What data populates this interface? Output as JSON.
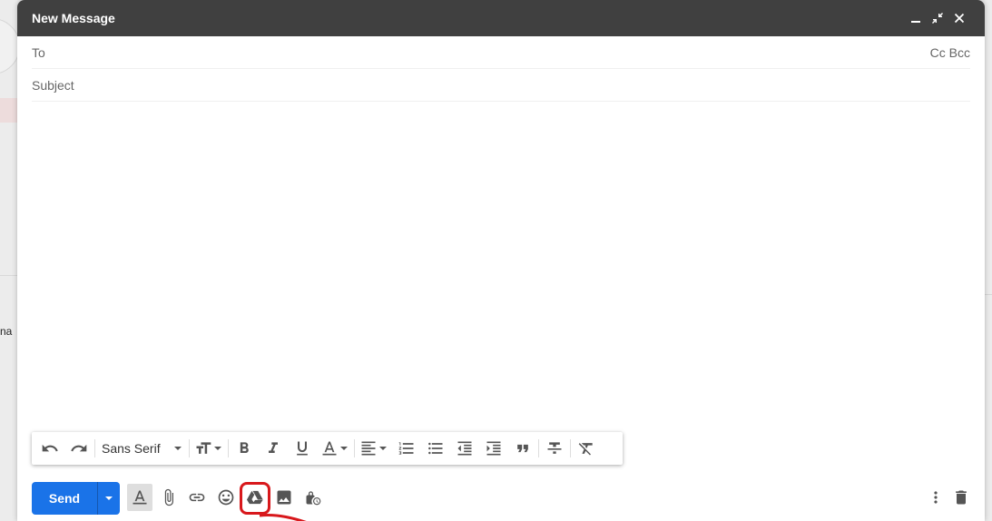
{
  "window": {
    "title": "New Message",
    "controls": [
      "minimize-icon",
      "exit-fullscreen-icon",
      "close-icon"
    ]
  },
  "recipients": {
    "to_placeholder": "To",
    "cc_label": "Cc",
    "bcc_label": "Bcc"
  },
  "subject": {
    "placeholder": "Subject"
  },
  "formatting_toolbar": {
    "font_family": "Sans Serif",
    "buttons": [
      "undo-icon",
      "redo-icon",
      "font-size-icon",
      "bold-icon",
      "italic-icon",
      "underline-icon",
      "text-color-icon",
      "align-icon",
      "numbered-list-icon",
      "bulleted-list-icon",
      "indent-less-icon",
      "indent-more-icon",
      "quote-icon",
      "strikethrough-icon",
      "remove-formatting-icon"
    ]
  },
  "bottom_toolbar": {
    "send_label": "Send",
    "buttons": [
      "formatting-options-icon",
      "attach-files-icon",
      "insert-link-icon",
      "insert-emoji-icon",
      "google-drive-icon",
      "insert-photo-icon",
      "confidential-mode-icon",
      "more-options-icon",
      "discard-draft-icon"
    ]
  },
  "background": {
    "partial_text": "na"
  },
  "colors": {
    "titlebar": "#404040",
    "send_button": "#1a73e8",
    "annotation": "#d8181c"
  }
}
